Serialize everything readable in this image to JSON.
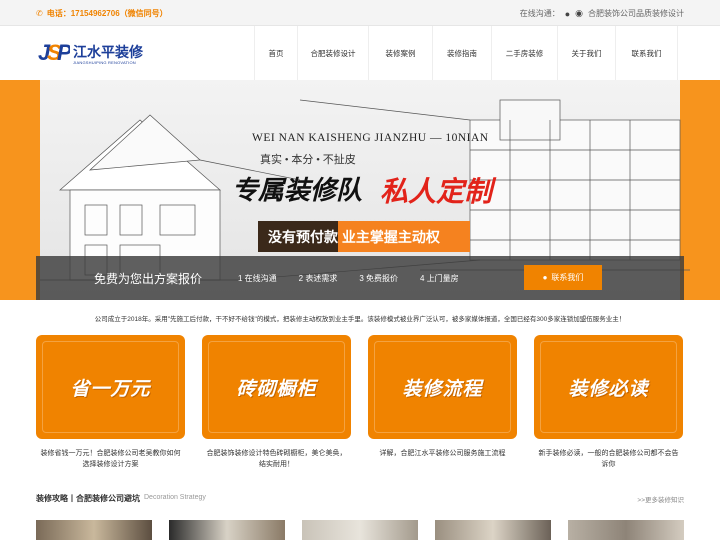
{
  "topbar": {
    "phone": "电话：17154962706（微信同号）",
    "online_label": "在线沟通：",
    "slogan": "合肥装饰公司品质装修设计"
  },
  "logo": {
    "mark": "JSP",
    "name": "江水平装修",
    "en": "JIANGSHUIPING RENOVATION"
  },
  "nav": {
    "items": [
      "首页",
      "合肥装修设计",
      "装修案例",
      "装修指南",
      "二手房装修",
      "关于我们",
      "联系我们"
    ]
  },
  "hero": {
    "slogan_en": "WEI NAN KAISHENG JIANZHU — 10NIAN",
    "slogan_sub": "真实 • 本分 • 不扯皮",
    "slogan_big": "专属装修队",
    "slogan_big_red": "私人定制",
    "bar_text": "没有预付款  业主掌握主动权"
  },
  "strip": {
    "title": "免费为您出方案报价",
    "steps": [
      "1  在线沟通",
      "2  表述需求",
      "3  免费报价",
      "4  上门量房"
    ],
    "cta": "联系我们"
  },
  "intro": "公司成立于2018年。采用\"先施工后付款，干不好不给钱\"的模式，把装修主动权放到业主手里。该装修模式被业界广泛认可，被多家媒体报道，全国已经有300多家连锁加盟伍服务业主！",
  "cards": [
    {
      "tile": "省一万元",
      "desc": "装修省钱一万元！合肥装修公司老吴教你如何选择装修设计方案"
    },
    {
      "tile": "砖砌橱柜",
      "desc": "合肥装饰装修设计特色砖砌橱柜，美仑美奂，结实耐用！"
    },
    {
      "tile": "装修流程",
      "desc": "详解，合肥江水平装修公司服务施工流程"
    },
    {
      "tile": "装修必读",
      "desc": "新手装修必读，一般的合肥装修公司都不会告诉你"
    }
  ],
  "section": {
    "title": "装修攻略丨合肥装修公司避坑",
    "en": "Decoration Strategy",
    "more": ">>更多装修知识"
  },
  "colors": {
    "accent": "#f08300",
    "brand": "#1d3f9a",
    "red": "#e2231a"
  }
}
